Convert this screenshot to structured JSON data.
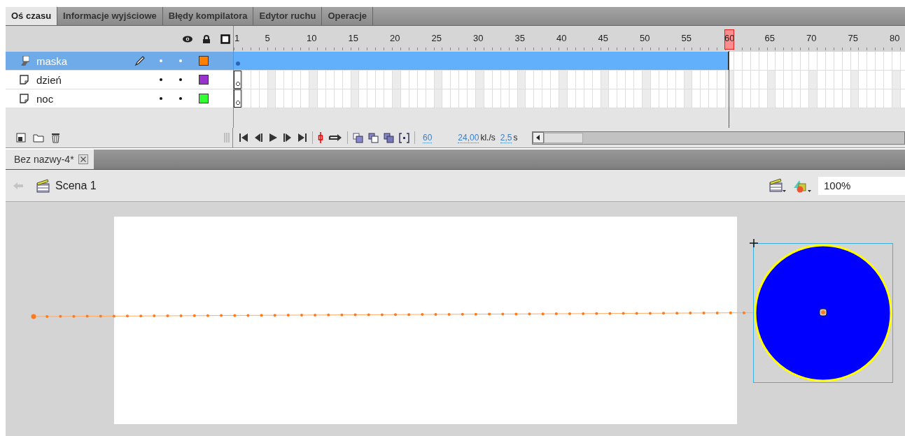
{
  "panel_tabs": [
    {
      "label": "Oś czasu",
      "selected": true
    },
    {
      "label": "Informacje wyjściowe",
      "selected": false
    },
    {
      "label": "Błędy kompilatora",
      "selected": false
    },
    {
      "label": "Edytor ruchu",
      "selected": false
    },
    {
      "label": "Operacje",
      "selected": false
    }
  ],
  "ruler": [
    {
      "label": "1",
      "selected": false
    },
    {
      "label": "5",
      "selected": false
    },
    {
      "label": "10",
      "selected": false
    },
    {
      "label": "15",
      "selected": false
    },
    {
      "label": "20",
      "selected": false
    },
    {
      "label": "25",
      "selected": false
    },
    {
      "label": "30",
      "selected": false
    },
    {
      "label": "35",
      "selected": false
    },
    {
      "label": "40",
      "selected": false
    },
    {
      "label": "45",
      "selected": false
    },
    {
      "label": "50",
      "selected": false
    },
    {
      "label": "55",
      "selected": false
    },
    {
      "label": "60",
      "selected": true
    },
    {
      "label": "65",
      "selected": false
    },
    {
      "label": "70",
      "selected": false
    },
    {
      "label": "75",
      "selected": false
    },
    {
      "label": "80",
      "selected": false
    }
  ],
  "layers": [
    {
      "name": "maska",
      "kind": "mask",
      "selected": true,
      "editing": true,
      "color": "#ff8000",
      "tweened": true
    },
    {
      "name": "dzień",
      "kind": "masked",
      "selected": false,
      "editing": false,
      "color": "#9933cc",
      "tweened": false
    },
    {
      "name": "noc",
      "kind": "masked",
      "selected": false,
      "editing": false,
      "color": "#33ff33",
      "tweened": false
    }
  ],
  "timeline_status": {
    "current_frame": "60",
    "frame_rate": "24,00",
    "frame_rate_unit": "kl./s",
    "elapsed": "2,5",
    "elapsed_unit": "s"
  },
  "document_tab": {
    "label": "Bez nazwy-4*",
    "selected": true
  },
  "scene_bar": {
    "scene": "Scena 1",
    "zoom": "100%"
  }
}
